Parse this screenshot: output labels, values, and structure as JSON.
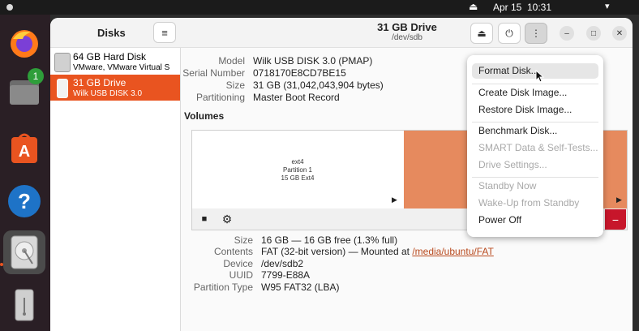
{
  "topbar": {
    "date": "Apr 15",
    "time": "10:31",
    "eject_glyph": "⏏",
    "system_glyphs": "▾"
  },
  "dock": {
    "files_badge": "1",
    "help_glyph": "?"
  },
  "sidebar": {
    "title": "Disks",
    "menu_glyph": "≡",
    "disks": [
      {
        "name": "64 GB Hard Disk",
        "sub": "VMware, VMware Virtual S"
      },
      {
        "name": "31 GB Drive",
        "sub": "Wilk USB DISK 3.0"
      }
    ]
  },
  "header": {
    "title": "31 GB Drive",
    "subtitle": "/dev/sdb",
    "eject_glyph": "⏏",
    "power_glyph": "⏻",
    "more_glyph": "⋮",
    "minimize_glyph": "–",
    "maximize_glyph": "□",
    "close_glyph": "✕"
  },
  "drive_info": {
    "labels": {
      "model": "Model",
      "serial": "Serial Number",
      "size": "Size",
      "partitioning": "Partitioning"
    },
    "values": {
      "model": "Wilk USB DISK 3.0 (PMAP)",
      "serial": "0718170E8CD7BE15",
      "size": "31 GB (31,042,043,904 bytes)",
      "partitioning": "Master Boot Record"
    }
  },
  "volumes": {
    "title": "Volumes",
    "partition1": {
      "fs": "ext4",
      "name": "Partition 1",
      "desc": "15 GB Ext4"
    },
    "stop_glyph": "■",
    "gear_glyph": "⚙",
    "play_glyph": "▶",
    "minus_glyph": "−"
  },
  "partition_info": {
    "labels": {
      "size": "Size",
      "contents": "Contents",
      "device": "Device",
      "uuid": "UUID",
      "type": "Partition Type"
    },
    "values": {
      "size": "16 GB — 16 GB free (1.3% full)",
      "contents_prefix": "FAT (32-bit version) — Mounted at ",
      "contents_link": "/media/ubuntu/FAT",
      "device": "/dev/sdb2",
      "uuid": "7799-E88A",
      "type": "W95 FAT32 (LBA)"
    }
  },
  "menu": {
    "format": "Format Disk...",
    "create_image": "Create Disk Image...",
    "restore_image": "Restore Disk Image...",
    "benchmark": "Benchmark Disk...",
    "smart": "SMART Data & Self-Tests...",
    "settings": "Drive Settings...",
    "standby": "Standby Now",
    "wakeup": "Wake-Up from Standby",
    "power_off": "Power Off"
  }
}
